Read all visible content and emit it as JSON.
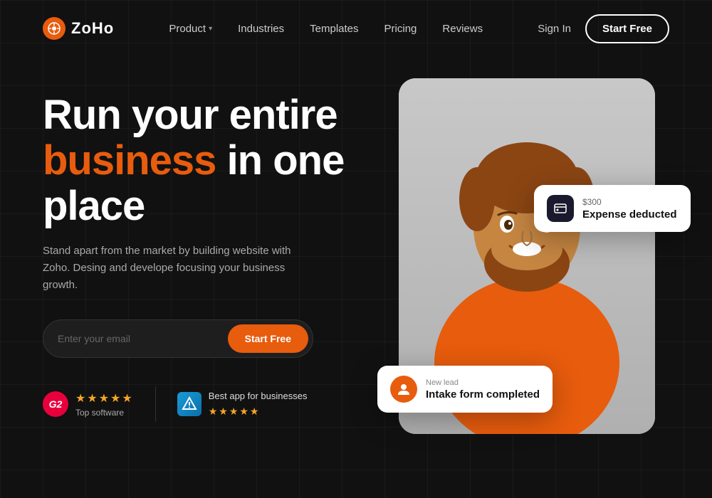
{
  "brand": {
    "logo_text": "ZoHo",
    "logo_icon": "⚙"
  },
  "nav": {
    "links": [
      {
        "label": "Product",
        "has_dropdown": true
      },
      {
        "label": "Industries",
        "has_dropdown": false
      },
      {
        "label": "Templates",
        "has_dropdown": false
      },
      {
        "label": "Pricing",
        "has_dropdown": false
      },
      {
        "label": "Reviews",
        "has_dropdown": false
      }
    ],
    "sign_in": "Sign In",
    "start_free": "Start Free"
  },
  "hero": {
    "headline_line1": "Run your entire",
    "headline_accent": "business",
    "headline_line2": "in one",
    "headline_line3": "place",
    "subtext": "Stand apart from the market by building website with Zoho. Desing and develope focusing your business growth.",
    "email_placeholder": "Enter your email",
    "cta_button": "Start Free"
  },
  "social_proof": {
    "g2_label": "Top software",
    "stars_g2": "★★★★★",
    "sendgrid_label": "Best app for businesses",
    "stars_sendgrid": "★★★★★"
  },
  "notifications": {
    "expense": {
      "amount": "$300",
      "title": "Expense deducted"
    },
    "lead": {
      "sub": "New lead",
      "title": "Intake form completed"
    }
  },
  "colors": {
    "accent": "#e85c0d",
    "dark_bg": "#111111",
    "card_bg": "#1e1e1e"
  }
}
